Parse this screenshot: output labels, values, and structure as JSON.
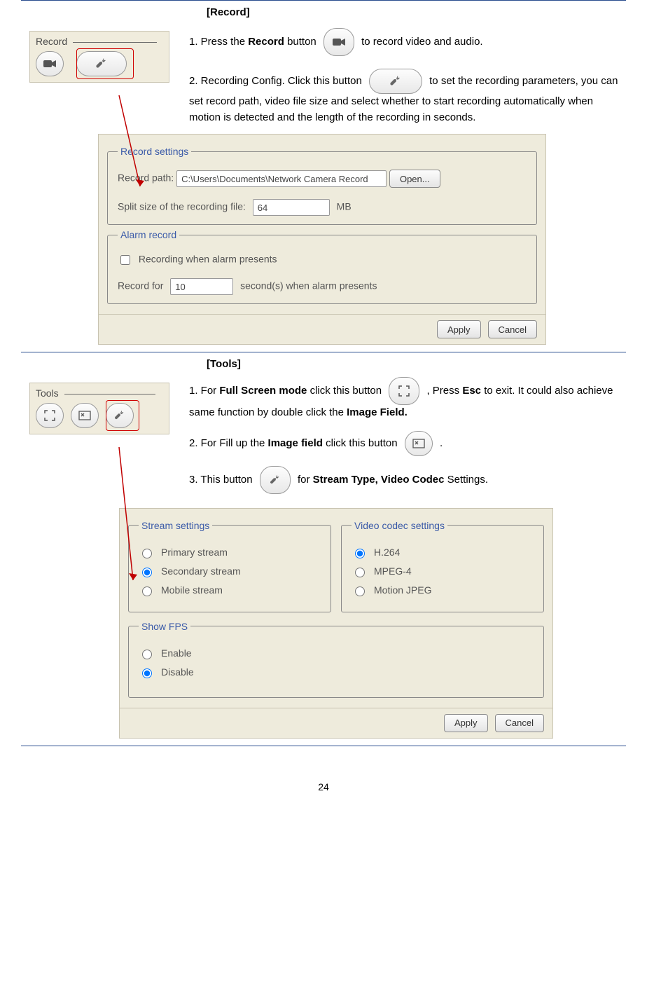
{
  "page_number": "24",
  "record_section": {
    "heading": "[Record]",
    "panel_title": "Record",
    "step1": {
      "prefix": "1. Press the ",
      "bold": "Record",
      "suffix": " button ",
      "tail": " to record video and audio."
    },
    "step2": "2. Recording Config. Click this button ",
    "step2_tail": "to set the recording parameters, you can set record path, video file size and select whether to start recording automatically when motion is detected and the length of the recording in seconds.",
    "dialog": {
      "record_settings_legend": "Record settings",
      "record_path_label": "Record path:",
      "record_path_value": "C:\\Users\\Documents\\Network Camera Record",
      "open_button": "Open...",
      "split_label_prefix": "Split size of the recording file:",
      "split_value": "64",
      "split_unit": "MB",
      "alarm_legend": "Alarm record",
      "alarm_checkbox_label": "Recording when alarm presents",
      "alarm_seconds_prefix": "Record for",
      "alarm_seconds_value": "10",
      "alarm_seconds_suffix": "second(s) when alarm presents",
      "apply": "Apply",
      "cancel": "Cancel"
    }
  },
  "tools_section": {
    "heading": "[Tools]",
    "panel_title": "Tools",
    "step1": {
      "p1": "1. For ",
      "b1": "Full Screen mode",
      "p2": " click this button ",
      "p3": " , Press ",
      "b2": "Esc",
      "p4": " to exit. It could also achieve same function by double click the ",
      "b3": "Image Field."
    },
    "step2": {
      "p1": "2. For Fill up the ",
      "b1": "Image field",
      "p2": " click this button ",
      "tail": " ."
    },
    "step3": {
      "p1": "3. This button ",
      "p2": " for ",
      "b1": "Stream Type, Video Codec",
      "p3": " Settings."
    },
    "dialog": {
      "stream_legend": "Stream settings",
      "stream_options": [
        "Primary stream",
        "Secondary stream",
        "Mobile stream"
      ],
      "stream_selected": 1,
      "codec_legend": "Video codec settings",
      "codec_options": [
        "H.264",
        "MPEG-4",
        "Motion JPEG"
      ],
      "codec_selected": 0,
      "fps_legend": "Show FPS",
      "fps_options": [
        "Enable",
        "Disable"
      ],
      "fps_selected": 1,
      "apply": "Apply",
      "cancel": "Cancel"
    }
  }
}
